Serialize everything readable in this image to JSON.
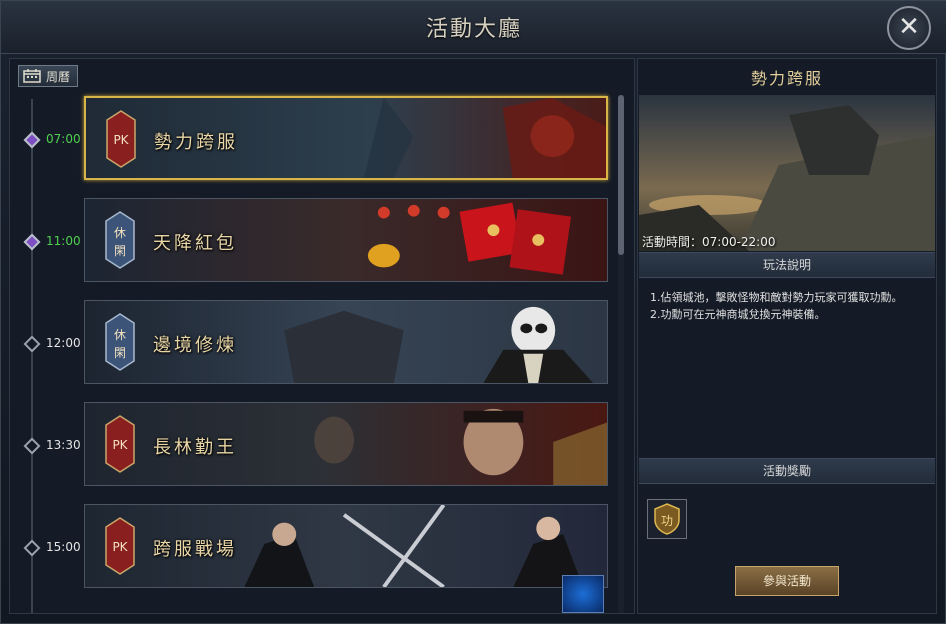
{
  "window": {
    "title": "活動大廳"
  },
  "left": {
    "weekly_label": "周曆"
  },
  "timeline": [
    {
      "time": "07:00",
      "active": true
    },
    {
      "time": "11:00",
      "active": true
    },
    {
      "time": "12:00",
      "active": false
    },
    {
      "time": "13:30",
      "active": false
    },
    {
      "time": "15:00",
      "active": false
    }
  ],
  "events": [
    {
      "badge": "PK",
      "badge_type": "pk",
      "name": "勢力跨服",
      "selected": true
    },
    {
      "badge": "休閑",
      "badge_type": "leisure",
      "name": "天降紅包",
      "selected": false
    },
    {
      "badge": "休閑",
      "badge_type": "leisure",
      "name": "邊境修煉",
      "selected": false
    },
    {
      "badge": "PK",
      "badge_type": "pk",
      "name": "長林勤王",
      "selected": false
    },
    {
      "badge": "PK",
      "badge_type": "pk",
      "name": "跨服戰場",
      "selected": false
    }
  ],
  "detail": {
    "title": "勢力跨服",
    "time_label": "活動時間：07:00-22:00",
    "rules_header": "玩法說明",
    "rules": [
      "1.佔領城池，擊敗怪物和敵對勢力玩家可獲取功勳。",
      "2.功勳可在元神商城兌換元神裝備。"
    ],
    "rewards_header": "活動獎勵",
    "reward_icon_char": "功",
    "join_label": "參與活動"
  },
  "colors": {
    "pk_badge": "#8a1f1f",
    "leisure_badge": "#3b5478",
    "selected_border": "#d8b548",
    "active_time": "#4fcf4f"
  }
}
